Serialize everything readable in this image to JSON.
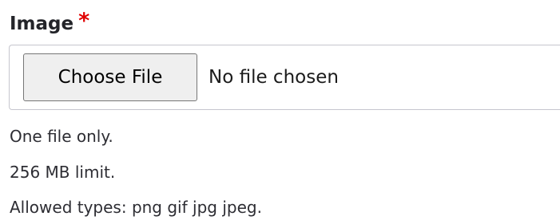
{
  "field": {
    "label": "Image",
    "required_mark": "*",
    "required_color": "#e00000"
  },
  "file_input": {
    "button_label": "Choose File",
    "status": "No file chosen"
  },
  "help": {
    "count": "One file only.",
    "size_limit": "256 MB limit.",
    "allowed_types": "Allowed types: png gif jpg jpeg."
  }
}
